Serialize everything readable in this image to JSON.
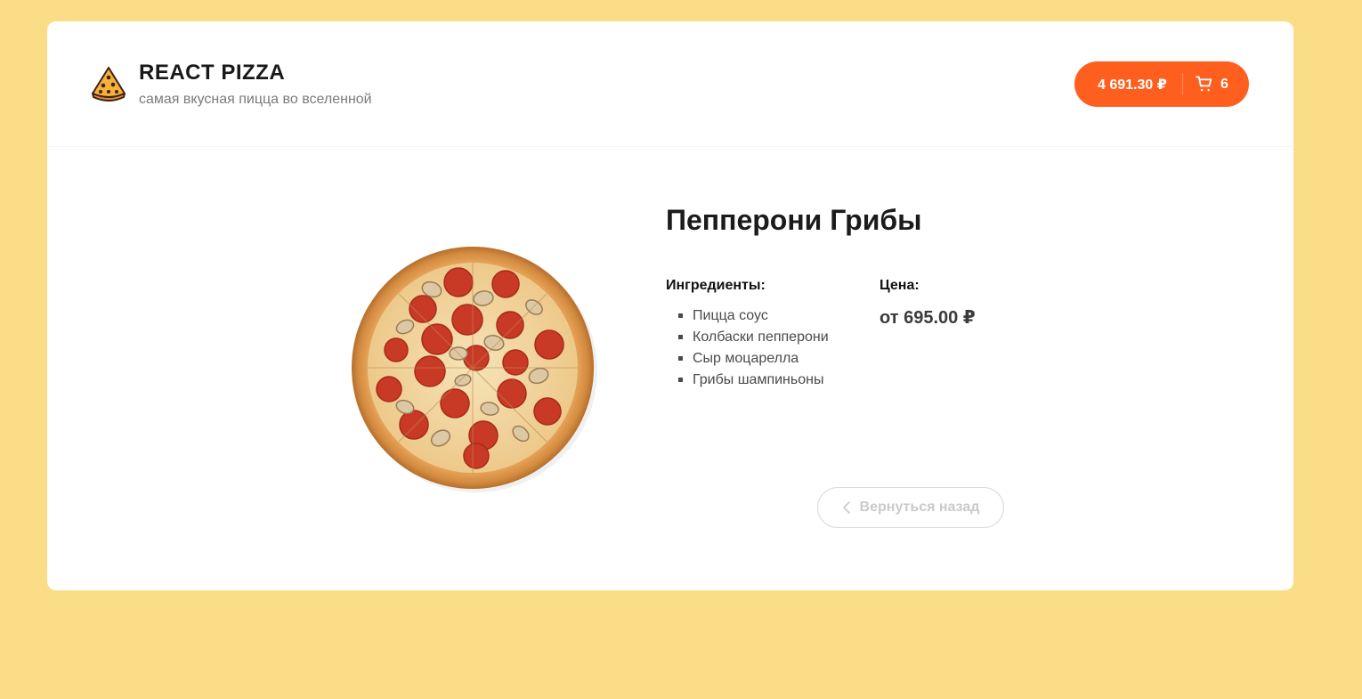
{
  "header": {
    "logo_icon": "pizza-slice-icon",
    "title": "REACT PIZZA",
    "subtitle": "самая вкусная пицца во вселенной",
    "cart": {
      "total": "4 691.30 ₽",
      "icon": "cart-icon",
      "count": "6",
      "color": "#fe5f1e"
    }
  },
  "pizza": {
    "image": "pepperoni-mushroom-pizza-image",
    "title": "Пепперони Грибы",
    "ingredients_label": "Ингредиенты:",
    "ingredients": [
      "Пицца соус",
      "Колбаски пепперони",
      "Сыр моцарелла",
      "Грибы шампиньоны"
    ],
    "price_label": "Цена:",
    "price": "от 695.00 ₽"
  },
  "back_button": {
    "icon": "chevron-left-icon",
    "label": "Вернуться назад"
  },
  "colors": {
    "page_background": "#fcdd87",
    "accent": "#fe5f1e"
  }
}
